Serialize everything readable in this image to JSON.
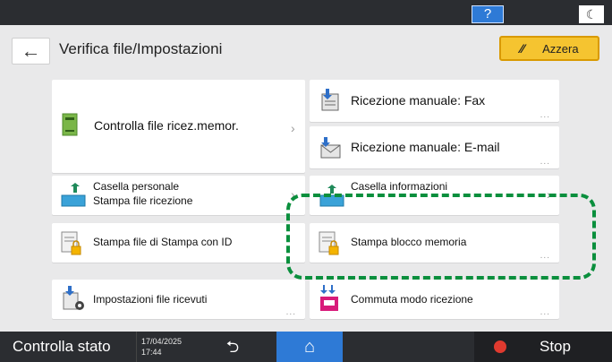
{
  "topbar": {
    "help_label": "?",
    "moon_label": "☾"
  },
  "header": {
    "back_glyph": "←",
    "title": "Verifica file/Impostazioni",
    "reset_label": "Azzera"
  },
  "tiles": {
    "controlla": {
      "label": "Controlla file ricez.memor.",
      "icon": "memory-file-icon"
    },
    "ric_fax": {
      "label": "Ricezione manuale: Fax",
      "icon": "fax-receive-icon"
    },
    "ric_email": {
      "label": "Ricezione manuale: E-mail",
      "icon": "email-receive-icon"
    },
    "casella_personale": {
      "line1": "Casella personale",
      "line2": "Stampa file ricezione",
      "icon": "personal-box-icon"
    },
    "casella_info": {
      "label": "Casella informazioni",
      "icon": "info-box-icon"
    },
    "stampa_id": {
      "label": "Stampa file di Stampa con ID",
      "icon": "locked-print-icon"
    },
    "stampa_blocco": {
      "label": "Stampa blocco memoria",
      "icon": "memory-lock-print-icon"
    },
    "impostazioni": {
      "label": "Impostazioni file ricevuti",
      "icon": "received-settings-icon"
    },
    "commuta": {
      "label": "Commuta modo ricezione",
      "icon": "switch-mode-icon"
    }
  },
  "bottombar": {
    "status_label": "Controlla stato",
    "date": "17/04/2025",
    "time": "17:44",
    "back_glyph": "⮌",
    "home_glyph": "⌂",
    "stop_label": "Stop"
  },
  "colors": {
    "accent": "#2e7ad6",
    "reset": "#f5c430",
    "highlight": "#0a8f3d",
    "stop": "#e03a2f"
  }
}
